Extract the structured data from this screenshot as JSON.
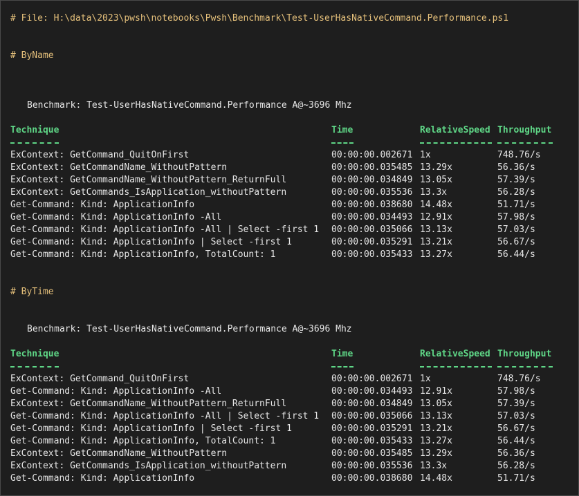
{
  "file_comment": "# File: H:\\data\\2023\\pwsh\\notebooks\\Pwsh\\Benchmark\\Test-UserHasNativeCommand.Performance.ps1",
  "sections": [
    {
      "heading": "# ByName",
      "benchmark": "Benchmark: Test-UserHasNativeCommand.Performance A@~3696 Mhz",
      "columns": [
        "Technique",
        "Time",
        "RelativeSpeed",
        "Throughput"
      ],
      "rows": [
        [
          "ExContext: GetCommand_QuitOnFirst",
          "00:00:00.002671",
          "1x",
          "748.76/s"
        ],
        [
          "ExContext: GetCommandName_WithoutPattern",
          "00:00:00.035485",
          "13.29x",
          "56.36/s"
        ],
        [
          "ExContext: GetCommandName_WithoutPattern_ReturnFull",
          "00:00:00.034849",
          "13.05x",
          "57.39/s"
        ],
        [
          "ExContext: GetCommands_IsApplication_withoutPattern",
          "00:00:00.035536",
          "13.3x",
          "56.28/s"
        ],
        [
          "Get-Command: Kind: ApplicationInfo",
          "00:00:00.038680",
          "14.48x",
          "51.71/s"
        ],
        [
          "Get-Command: Kind: ApplicationInfo -All",
          "00:00:00.034493",
          "12.91x",
          "57.98/s"
        ],
        [
          "Get-Command: Kind: ApplicationInfo -All | Select -first 1",
          "00:00:00.035066",
          "13.13x",
          "57.03/s"
        ],
        [
          "Get-Command: Kind: ApplicationInfo | Select -first 1",
          "00:00:00.035291",
          "13.21x",
          "56.67/s"
        ],
        [
          "Get-Command: Kind: ApplicationInfo, TotalCount: 1",
          "00:00:00.035433",
          "13.27x",
          "56.44/s"
        ]
      ]
    },
    {
      "heading": "# ByTime",
      "benchmark": "Benchmark: Test-UserHasNativeCommand.Performance A@~3696 Mhz",
      "columns": [
        "Technique",
        "Time",
        "RelativeSpeed",
        "Throughput"
      ],
      "rows": [
        [
          "ExContext: GetCommand_QuitOnFirst",
          "00:00:00.002671",
          "1x",
          "748.76/s"
        ],
        [
          "Get-Command: Kind: ApplicationInfo -All",
          "00:00:00.034493",
          "12.91x",
          "57.98/s"
        ],
        [
          "ExContext: GetCommandName_WithoutPattern_ReturnFull",
          "00:00:00.034849",
          "13.05x",
          "57.39/s"
        ],
        [
          "Get-Command: Kind: ApplicationInfo -All | Select -first 1",
          "00:00:00.035066",
          "13.13x",
          "57.03/s"
        ],
        [
          "Get-Command: Kind: ApplicationInfo | Select -first 1",
          "00:00:00.035291",
          "13.21x",
          "56.67/s"
        ],
        [
          "Get-Command: Kind: ApplicationInfo, TotalCount: 1",
          "00:00:00.035433",
          "13.27x",
          "56.44/s"
        ],
        [
          "ExContext: GetCommandName_WithoutPattern",
          "00:00:00.035485",
          "13.29x",
          "56.36/s"
        ],
        [
          "ExContext: GetCommands_IsApplication_withoutPattern",
          "00:00:00.035536",
          "13.3x",
          "56.28/s"
        ],
        [
          "Get-Command: Kind: ApplicationInfo",
          "00:00:00.038680",
          "14.48x",
          "51.71/s"
        ]
      ]
    }
  ]
}
